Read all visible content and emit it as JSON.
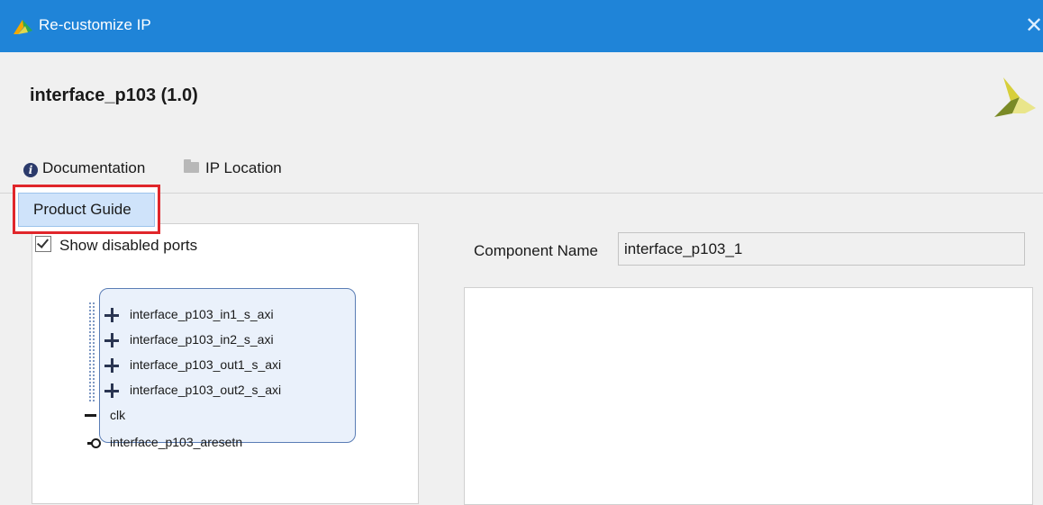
{
  "window": {
    "title": "Re-customize IP",
    "close_glyph": "✕"
  },
  "ip": {
    "name": "interface_p103 (1.0)"
  },
  "toolbar": {
    "documentation_label": "Documentation",
    "ip_location_label": "IP Location"
  },
  "documentation_menu": {
    "items": [
      {
        "label": "Product Guide"
      }
    ]
  },
  "symbol_panel": {
    "show_disabled_ports_label": "Show disabled ports",
    "show_disabled_ports_checked": true,
    "ports": [
      {
        "label": "interface_p103_in1_s_axi",
        "icon": "plus-icon"
      },
      {
        "label": "interface_p103_in2_s_axi",
        "icon": "plus-icon"
      },
      {
        "label": "interface_p103_out1_s_axi",
        "icon": "plus-icon"
      },
      {
        "label": "interface_p103_out2_s_axi",
        "icon": "plus-icon"
      },
      {
        "label": "clk",
        "icon": "line-icon"
      },
      {
        "label": "interface_p103_aresetn",
        "icon": "reset-icon"
      }
    ]
  },
  "config_panel": {
    "component_name_label": "Component Name",
    "component_name_value": "interface_p103_1"
  },
  "colors": {
    "titlebar": "#1f84d8",
    "highlight_border": "#e0262b",
    "menu_item_bg": "#cfe3fa",
    "ip_block_bg": "#eaf1fb",
    "ip_block_border": "#5a7db5"
  }
}
